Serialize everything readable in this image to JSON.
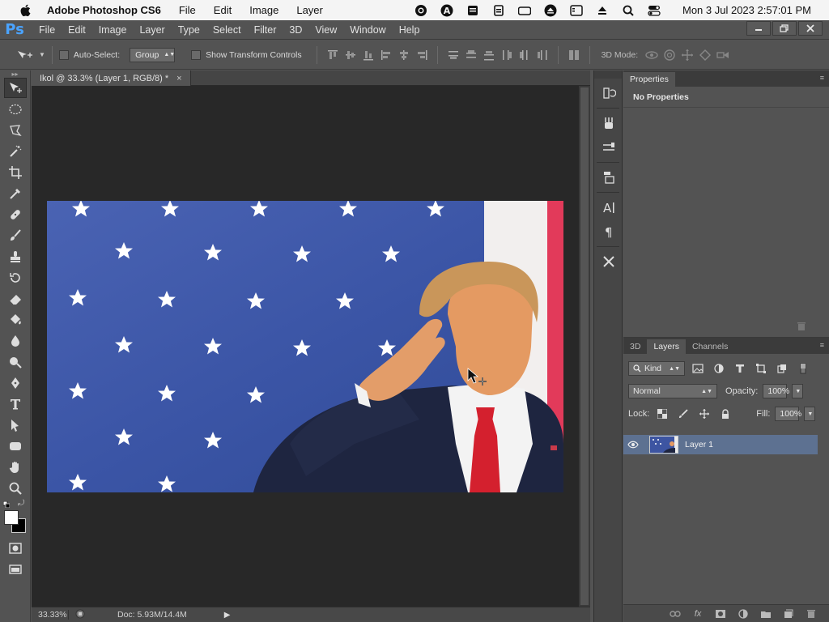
{
  "macos": {
    "app_name": "Adobe Photoshop CS6",
    "menus": [
      "File",
      "Edit",
      "Image",
      "Layer"
    ],
    "clock": "Mon 3 Jul 2023  2:57:01 PM"
  },
  "ps": {
    "logo": "Ps",
    "menus": [
      "File",
      "Edit",
      "Image",
      "Layer",
      "Type",
      "Select",
      "Filter",
      "3D",
      "View",
      "Window",
      "Help"
    ]
  },
  "options": {
    "auto_select_label": "Auto-Select:",
    "auto_select_value": "Group",
    "show_transform_label": "Show Transform Controls",
    "mode_3d_label": "3D Mode:"
  },
  "document": {
    "tab_title": "Ikol @ 33.3% (Layer 1, RGB/8) *",
    "zoom": "33.33%",
    "doc_size": "Doc: 5.93M/14.4M"
  },
  "properties": {
    "tab": "Properties",
    "body": "No Properties"
  },
  "layers": {
    "tabs": [
      "3D",
      "Layers",
      "Channels"
    ],
    "filter_kind": "Kind",
    "blend_mode": "Normal",
    "opacity_label": "Opacity:",
    "opacity_value": "100%",
    "lock_label": "Lock:",
    "fill_label": "Fill:",
    "fill_value": "100%",
    "layer_name": "Layer 1"
  },
  "colors": {
    "foreground": "#ffffff",
    "background": "#000000",
    "selected_layer": "#5d7191",
    "logo_blue": "#4aa3ff"
  }
}
